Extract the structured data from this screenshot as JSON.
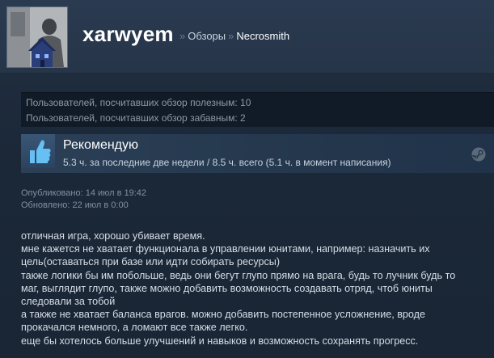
{
  "header": {
    "username": "xarwyem",
    "breadcrumb": {
      "separator": "»",
      "section": "Обзоры",
      "game": "Necrosmith"
    }
  },
  "votes": {
    "helpful": "Пользователей, посчитавших обзор полезным: 10",
    "funny": "Пользователей, посчитавших обзор забавным: 2"
  },
  "recommendation": {
    "title": "Рекомендую",
    "hours": "5.3 ч. за последние две недели / 8.5 ч. всего (5.1 ч. в момент написания)",
    "icon": "thumbs-up-icon",
    "platform_icon": "steam-icon"
  },
  "dates": {
    "posted": "Опубликовано: 14 июл в 19:42",
    "updated": "Обновлено: 22 июл в 0:00"
  },
  "review_lines": [
    "отличная игра, хорошо убивает время.",
    "мне кажется не хватает функционала в управлении юнитами, например: назначить их",
    "цель(оставаться при базе или идти собирать ресурсы)",
    "также логики бы им побольше, ведь они бегут глупо прямо на врага, будь то лучник будь то",
    "маг, выглядит глупо, также можно добавить возможность создавать отряд, чтоб юниты",
    "следовали за тобой",
    "а также не хватает баланса врагов. можно добавить постепенное усложнение, вроде",
    "прокачался немного, а ломают все также легко.",
    "еще бы хотелось больше улучшений и навыков и возможность сохранять прогресс."
  ],
  "colors": {
    "background": "#1b2838",
    "header": "#2a3a50",
    "recommend_panel": "#2b3f56",
    "accent_blue": "#66c0f4"
  }
}
